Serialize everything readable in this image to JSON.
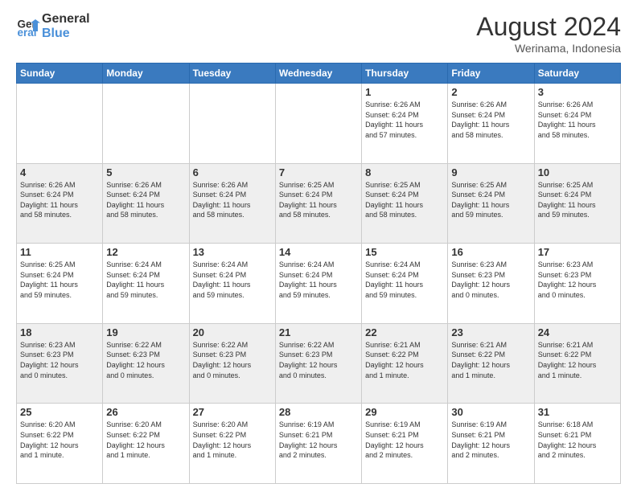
{
  "header": {
    "logo_line1": "General",
    "logo_line2": "Blue",
    "month_year": "August 2024",
    "location": "Werinama, Indonesia"
  },
  "weekdays": [
    "Sunday",
    "Monday",
    "Tuesday",
    "Wednesday",
    "Thursday",
    "Friday",
    "Saturday"
  ],
  "weeks": [
    [
      {
        "day": "",
        "info": ""
      },
      {
        "day": "",
        "info": ""
      },
      {
        "day": "",
        "info": ""
      },
      {
        "day": "",
        "info": ""
      },
      {
        "day": "1",
        "info": "Sunrise: 6:26 AM\nSunset: 6:24 PM\nDaylight: 11 hours\nand 57 minutes."
      },
      {
        "day": "2",
        "info": "Sunrise: 6:26 AM\nSunset: 6:24 PM\nDaylight: 11 hours\nand 58 minutes."
      },
      {
        "day": "3",
        "info": "Sunrise: 6:26 AM\nSunset: 6:24 PM\nDaylight: 11 hours\nand 58 minutes."
      }
    ],
    [
      {
        "day": "4",
        "info": "Sunrise: 6:26 AM\nSunset: 6:24 PM\nDaylight: 11 hours\nand 58 minutes."
      },
      {
        "day": "5",
        "info": "Sunrise: 6:26 AM\nSunset: 6:24 PM\nDaylight: 11 hours\nand 58 minutes."
      },
      {
        "day": "6",
        "info": "Sunrise: 6:26 AM\nSunset: 6:24 PM\nDaylight: 11 hours\nand 58 minutes."
      },
      {
        "day": "7",
        "info": "Sunrise: 6:25 AM\nSunset: 6:24 PM\nDaylight: 11 hours\nand 58 minutes."
      },
      {
        "day": "8",
        "info": "Sunrise: 6:25 AM\nSunset: 6:24 PM\nDaylight: 11 hours\nand 58 minutes."
      },
      {
        "day": "9",
        "info": "Sunrise: 6:25 AM\nSunset: 6:24 PM\nDaylight: 11 hours\nand 59 minutes."
      },
      {
        "day": "10",
        "info": "Sunrise: 6:25 AM\nSunset: 6:24 PM\nDaylight: 11 hours\nand 59 minutes."
      }
    ],
    [
      {
        "day": "11",
        "info": "Sunrise: 6:25 AM\nSunset: 6:24 PM\nDaylight: 11 hours\nand 59 minutes."
      },
      {
        "day": "12",
        "info": "Sunrise: 6:24 AM\nSunset: 6:24 PM\nDaylight: 11 hours\nand 59 minutes."
      },
      {
        "day": "13",
        "info": "Sunrise: 6:24 AM\nSunset: 6:24 PM\nDaylight: 11 hours\nand 59 minutes."
      },
      {
        "day": "14",
        "info": "Sunrise: 6:24 AM\nSunset: 6:24 PM\nDaylight: 11 hours\nand 59 minutes."
      },
      {
        "day": "15",
        "info": "Sunrise: 6:24 AM\nSunset: 6:24 PM\nDaylight: 11 hours\nand 59 minutes."
      },
      {
        "day": "16",
        "info": "Sunrise: 6:23 AM\nSunset: 6:23 PM\nDaylight: 12 hours\nand 0 minutes."
      },
      {
        "day": "17",
        "info": "Sunrise: 6:23 AM\nSunset: 6:23 PM\nDaylight: 12 hours\nand 0 minutes."
      }
    ],
    [
      {
        "day": "18",
        "info": "Sunrise: 6:23 AM\nSunset: 6:23 PM\nDaylight: 12 hours\nand 0 minutes."
      },
      {
        "day": "19",
        "info": "Sunrise: 6:22 AM\nSunset: 6:23 PM\nDaylight: 12 hours\nand 0 minutes."
      },
      {
        "day": "20",
        "info": "Sunrise: 6:22 AM\nSunset: 6:23 PM\nDaylight: 12 hours\nand 0 minutes."
      },
      {
        "day": "21",
        "info": "Sunrise: 6:22 AM\nSunset: 6:23 PM\nDaylight: 12 hours\nand 0 minutes."
      },
      {
        "day": "22",
        "info": "Sunrise: 6:21 AM\nSunset: 6:22 PM\nDaylight: 12 hours\nand 1 minute."
      },
      {
        "day": "23",
        "info": "Sunrise: 6:21 AM\nSunset: 6:22 PM\nDaylight: 12 hours\nand 1 minute."
      },
      {
        "day": "24",
        "info": "Sunrise: 6:21 AM\nSunset: 6:22 PM\nDaylight: 12 hours\nand 1 minute."
      }
    ],
    [
      {
        "day": "25",
        "info": "Sunrise: 6:20 AM\nSunset: 6:22 PM\nDaylight: 12 hours\nand 1 minute."
      },
      {
        "day": "26",
        "info": "Sunrise: 6:20 AM\nSunset: 6:22 PM\nDaylight: 12 hours\nand 1 minute."
      },
      {
        "day": "27",
        "info": "Sunrise: 6:20 AM\nSunset: 6:22 PM\nDaylight: 12 hours\nand 1 minute."
      },
      {
        "day": "28",
        "info": "Sunrise: 6:19 AM\nSunset: 6:21 PM\nDaylight: 12 hours\nand 2 minutes."
      },
      {
        "day": "29",
        "info": "Sunrise: 6:19 AM\nSunset: 6:21 PM\nDaylight: 12 hours\nand 2 minutes."
      },
      {
        "day": "30",
        "info": "Sunrise: 6:19 AM\nSunset: 6:21 PM\nDaylight: 12 hours\nand 2 minutes."
      },
      {
        "day": "31",
        "info": "Sunrise: 6:18 AM\nSunset: 6:21 PM\nDaylight: 12 hours\nand 2 minutes."
      }
    ]
  ]
}
